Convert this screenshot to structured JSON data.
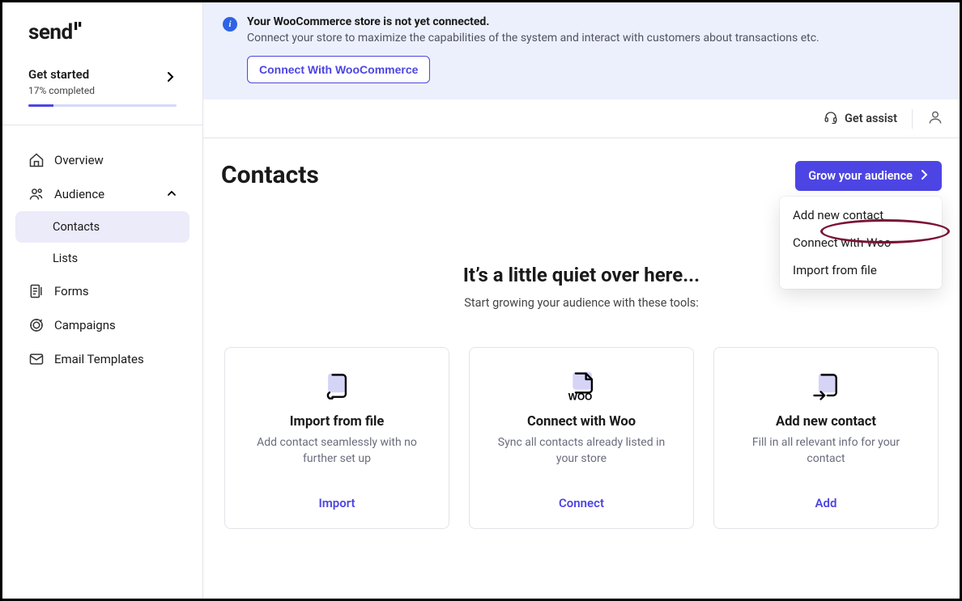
{
  "logo": "send",
  "get_started": {
    "title": "Get started",
    "percent": "17%",
    "completed_label": "completed"
  },
  "nav": {
    "overview": "Overview",
    "audience": "Audience",
    "contacts": "Contacts",
    "lists": "Lists",
    "forms": "Forms",
    "campaigns": "Campaigns",
    "email_templates": "Email Templates"
  },
  "banner": {
    "title": "Your WooCommerce store is not yet connected.",
    "desc": "Connect your store to maximize the capabilities of the system and interact with customers about transactions etc.",
    "button": "Connect With WooCommerce"
  },
  "topbar": {
    "assist": "Get assist"
  },
  "page": {
    "title": "Contacts",
    "grow_button": "Grow your audience"
  },
  "dropdown": {
    "add_contact": "Add new contact",
    "connect_woo": "Connect with Woo",
    "import_file": "Import from file"
  },
  "empty": {
    "title": "It’s a little quiet over here...",
    "sub": "Start growing your audience with these tools:"
  },
  "cards": {
    "import": {
      "title": "Import from file",
      "desc": "Add contact seamlessly with no further set up",
      "action": "Import"
    },
    "woo": {
      "title": "Connect with Woo",
      "desc": "Sync all contacts already listed in your store",
      "action": "Connect"
    },
    "add": {
      "title": "Add new contact",
      "desc": "Fill in all relevant info for your contact",
      "action": "Add"
    }
  }
}
